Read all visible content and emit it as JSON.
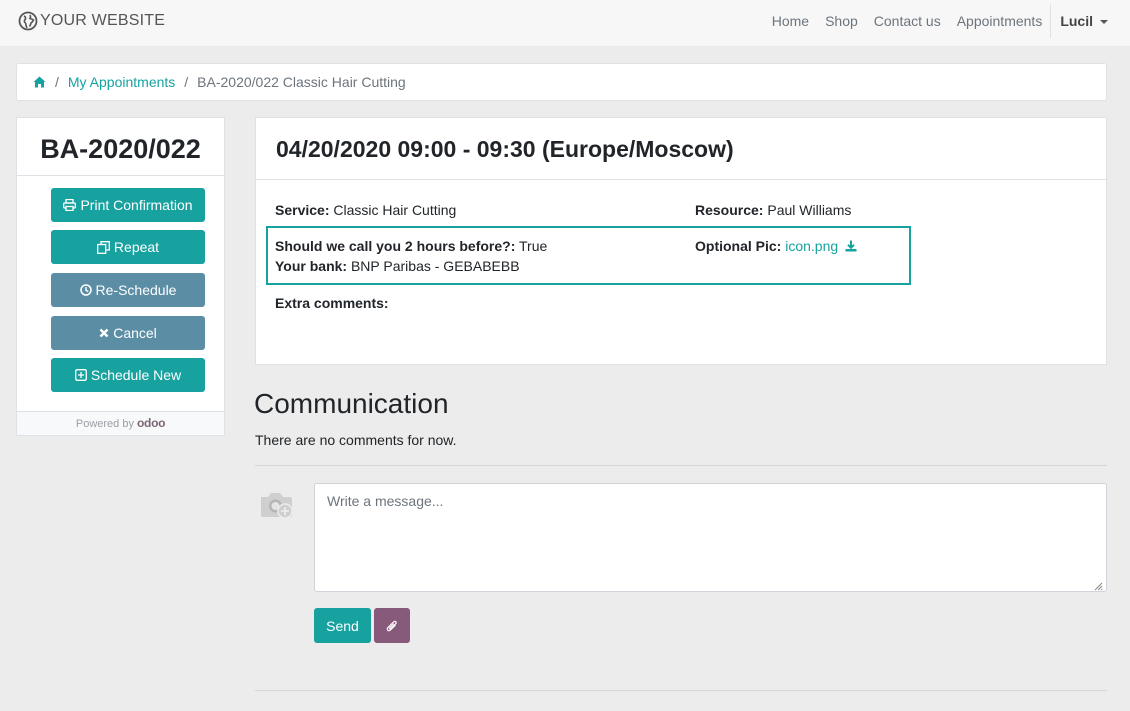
{
  "navbar": {
    "brand": "YOUR WEBSITE",
    "links": [
      "Home",
      "Shop",
      "Contact us",
      "Appointments"
    ],
    "user": "Lucil"
  },
  "breadcrumb": {
    "link": "My Appointments",
    "current": "BA-2020/022 Classic Hair Cutting"
  },
  "sidebar": {
    "title": "BA-2020/022",
    "buttons": {
      "print": "Print Confirmation",
      "repeat": "Repeat",
      "reschedule": "Re-Schedule",
      "cancel": "Cancel",
      "schedule_new": "Schedule New"
    },
    "powered_by": "Powered by",
    "powered_brand": "odoo"
  },
  "appointment": {
    "heading": "04/20/2020 09:00 - 09:30 (Europe/Moscow)",
    "service_label": "Service:",
    "service": "Classic Hair Cutting",
    "resource_label": "Resource:",
    "resource": "Paul Williams",
    "call_label": "Should we call you 2 hours before?:",
    "call_value": "True",
    "bank_label": "Your bank:",
    "bank_value": "BNP Paribas - GEBABEBB",
    "pic_label": "Optional Pic:",
    "pic_file": "icon.png",
    "comments_label": "Extra comments:"
  },
  "communication": {
    "title": "Communication",
    "empty": "There are no comments for now.",
    "placeholder": "Write a message...",
    "send": "Send"
  },
  "colors": {
    "primary": "#17a2a0",
    "secondary": "#5b8ea4",
    "odoo_purple": "#875a7b"
  }
}
